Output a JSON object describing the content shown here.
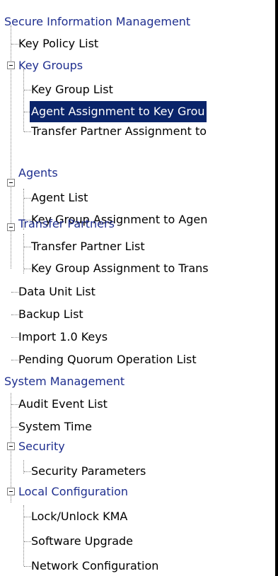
{
  "tree": {
    "sim": {
      "label": "Secure Information Management",
      "key_policy_list": "Key Policy List",
      "key_groups": {
        "label": "Key Groups",
        "key_group_list": "Key Group List",
        "agent_assignment": "Agent Assignment to Key Grou",
        "transfer_partner_assignment": "Transfer Partner Assignment to"
      },
      "agents": {
        "label": "Agents",
        "agent_list": "Agent List",
        "key_group_assignment": "Key Group Assignment to Agen"
      },
      "transfer_partners": {
        "label": "Transfer Partners",
        "transfer_partner_list": "Transfer Partner List",
        "key_group_assignment": "Key Group Assignment to Trans"
      },
      "data_unit_list": "Data Unit List",
      "backup_list": "Backup List",
      "import_keys": "Import 1.0 Keys",
      "pending_quorum": "Pending Quorum Operation List"
    },
    "sysmgmt": {
      "label": "System Management",
      "audit_event_list": "Audit Event List",
      "system_time": "System Time",
      "security": {
        "label": "Security",
        "security_parameters": "Security Parameters"
      },
      "local_configuration": {
        "label": "Local Configuration",
        "lock_unlock": "Lock/Unlock KMA",
        "software_upgrade": "Software Upgrade",
        "network_configuration": "Network Configuration"
      }
    }
  },
  "colors": {
    "group_text": "#1f2f8f",
    "selected_bg": "#0a246a",
    "selected_text": "#ffffff"
  }
}
